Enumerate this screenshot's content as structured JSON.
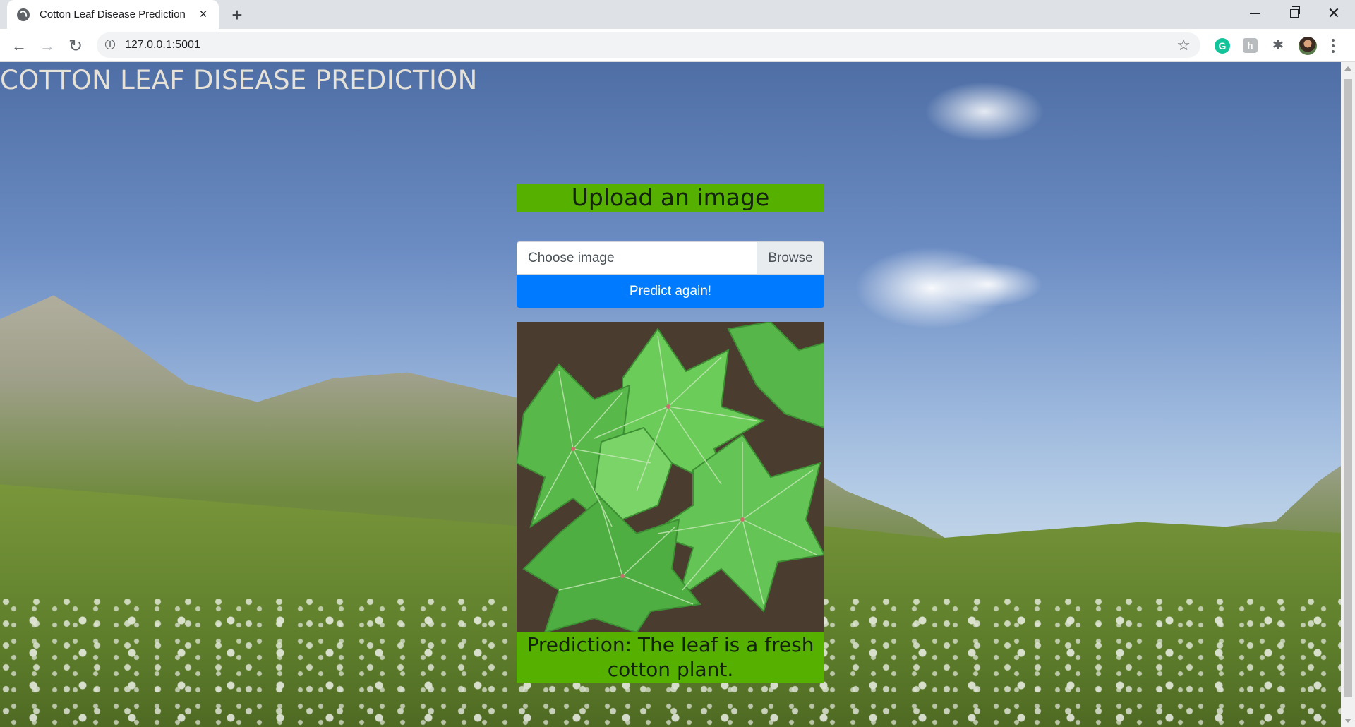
{
  "browser": {
    "tab_title": "Cotton Leaf Disease Prediction",
    "tab_close": "×",
    "new_tab": "+",
    "url": "127.0.0.1:5001",
    "extensions": {
      "grammarly": "G",
      "h_ext": "h"
    }
  },
  "page": {
    "title": "COTTON LEAF DISEASE PREDICTION",
    "upload_heading": "Upload an image",
    "file_input": {
      "placeholder": "Choose image",
      "browse_label": "Browse"
    },
    "predict_button": "Predict again!",
    "prediction_text": "Prediction: The leaf is a fresh cotton plant."
  },
  "colors": {
    "heading_bg": "#55b000",
    "button_bg": "#007bff",
    "title_color": "#e6e2d7"
  },
  "icons": [
    "globe-icon",
    "close-icon",
    "plus-icon",
    "back-icon",
    "forward-icon",
    "reload-icon",
    "info-icon",
    "star-icon",
    "grammarly-icon",
    "extension-icon",
    "puzzle-icon",
    "avatar",
    "menu-icon",
    "minimize-icon",
    "maximize-icon",
    "window-close-icon"
  ]
}
